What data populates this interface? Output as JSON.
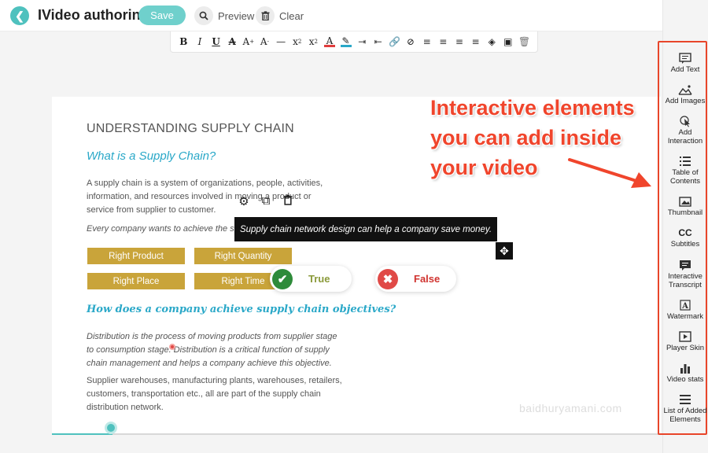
{
  "header": {
    "back_icon": "chevron-left-icon",
    "title": "IVideo authoring",
    "save_label": "Save",
    "preview_label": "Preview",
    "clear_label": "Clear"
  },
  "format_toolbar": {
    "tools": [
      "bold",
      "italic",
      "underline",
      "strikethrough",
      "superscript-size",
      "subscript-size",
      "horizontal-rule",
      "subscript",
      "superscript",
      "font-color",
      "highlight",
      "indent",
      "outdent",
      "link",
      "unlink",
      "align-left",
      "align-center",
      "align-right",
      "justify",
      "eraser",
      "image",
      "delete"
    ]
  },
  "sidebar": {
    "items": [
      {
        "label": "Add Text",
        "icon": "comment-icon"
      },
      {
        "label": "Add Images",
        "icon": "image-add-icon"
      },
      {
        "label": "Add Interaction",
        "icon": "pointer-icon"
      },
      {
        "label": "Table of Contents",
        "icon": "list-icon"
      },
      {
        "label": "Thumbnail",
        "icon": "picture-icon"
      },
      {
        "label": "Subtitles",
        "icon": "cc-icon"
      },
      {
        "label": "Interactive Transcript",
        "icon": "transcript-icon"
      },
      {
        "label": "Watermark",
        "icon": "watermark-icon"
      },
      {
        "label": "Player Skin",
        "icon": "play-icon"
      },
      {
        "label": "Video stats",
        "icon": "bar-chart-icon"
      },
      {
        "label": "List of Added Elements",
        "icon": "menu-icon"
      }
    ]
  },
  "slide": {
    "title": "UNDERSTANDING SUPPLY CHAIN",
    "subtitle": "What is a Supply Chain?",
    "para1": "A supply chain is a system of organizations, people, activities, information, and resources involved in moving a product or service from supplier to customer.",
    "para2": "Every company wants to achieve the supply",
    "buttons": [
      "Right Product",
      "Right Quantity",
      "Right Place",
      "Right Time"
    ],
    "section_heading": "How does a company achieve supply chain objectives?",
    "para4": "Distribution is the process of moving products from supplier stage to consumption stage. Distribution is a critical function of supply chain management and  helps a company achieve this objective.",
    "para5": "Supplier warehouses, manufacturing plants, warehouses, retailers, customers, transportation  etc., all are part of the supply chain distribution network."
  },
  "interaction": {
    "caption": "Supply chain network design can help a company save money.",
    "true_label": "True",
    "false_label": "False"
  },
  "annotation": {
    "text": "Interactive elements you can add inside your video",
    "color": "#f0452c"
  },
  "watermark": "baidhuryamani.com",
  "timeline": {
    "progress_percent": 10
  },
  "colors": {
    "accent": "#4fc1be",
    "gold": "#c9a43a",
    "heading_blue": "#2aa8c8"
  }
}
